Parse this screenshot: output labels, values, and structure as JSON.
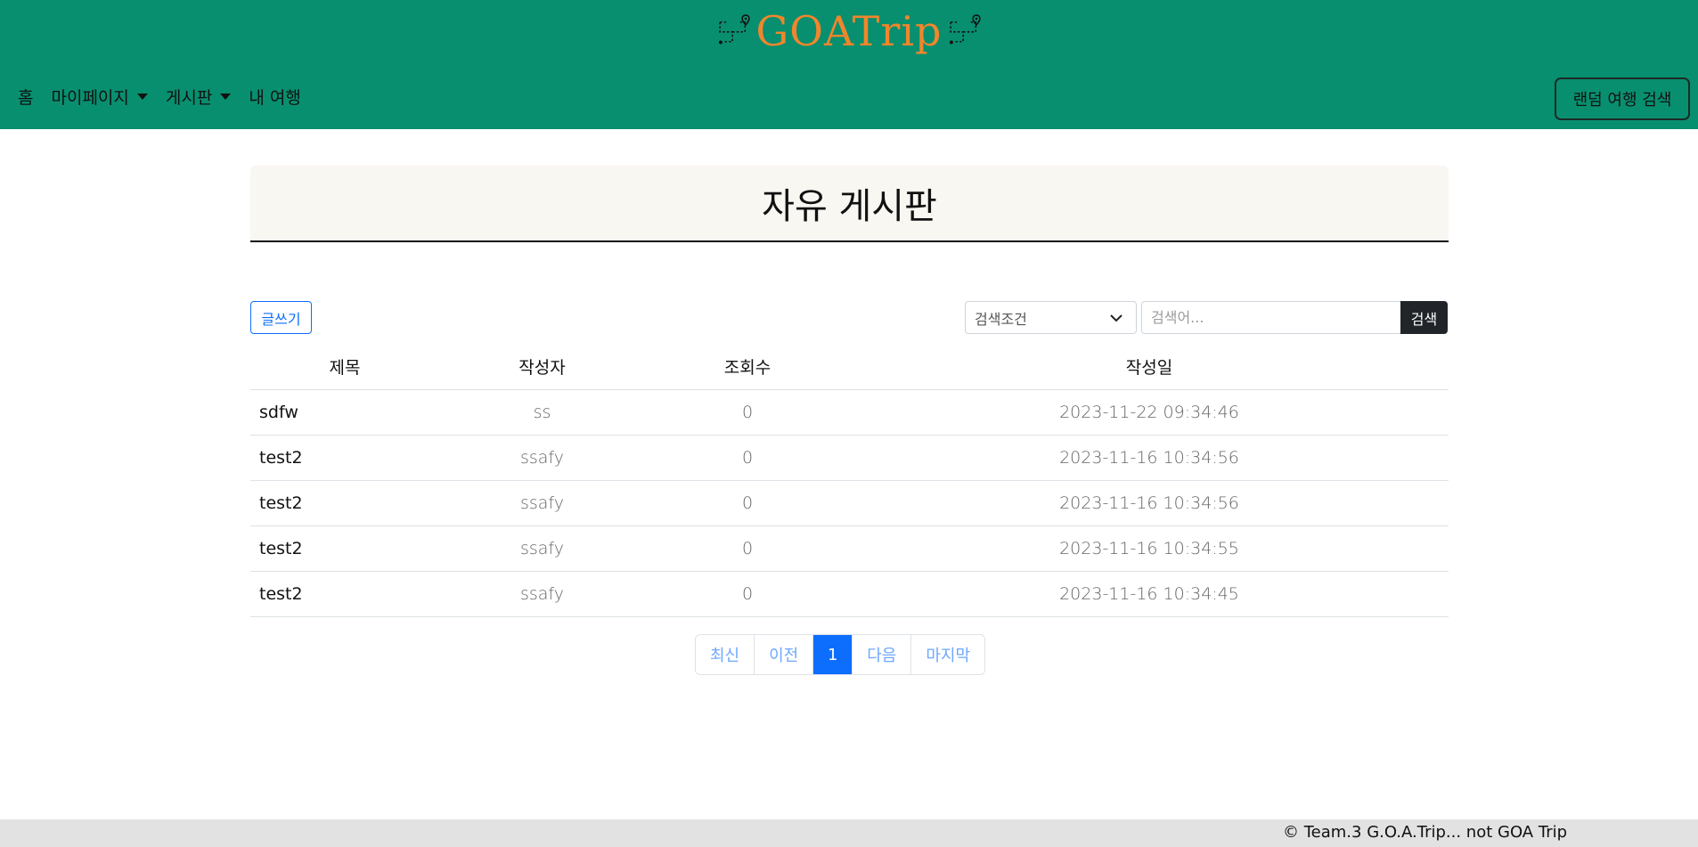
{
  "app": {
    "logo_text": "GOATrip"
  },
  "nav": {
    "home": "홈",
    "mypage": "마이페이지",
    "board": "게시판",
    "my_trip": "내 여행",
    "random_search": "랜덤 여행 검색"
  },
  "board": {
    "title": "자유 게시판",
    "write_label": "글쓰기",
    "search_condition": "검색조건",
    "search_placeholder": "검색어...",
    "search_label": "검색",
    "columns": {
      "title": "제목",
      "author": "작성자",
      "views": "조회수",
      "date": "작성일"
    },
    "rows": [
      {
        "title": "sdfw",
        "author": "ss",
        "views": "0",
        "date": "2023-11-22 09:34:46"
      },
      {
        "title": "test2",
        "author": "ssafy",
        "views": "0",
        "date": "2023-11-16 10:34:56"
      },
      {
        "title": "test2",
        "author": "ssafy",
        "views": "0",
        "date": "2023-11-16 10:34:56"
      },
      {
        "title": "test2",
        "author": "ssafy",
        "views": "0",
        "date": "2023-11-16 10:34:55"
      },
      {
        "title": "test2",
        "author": "ssafy",
        "views": "0",
        "date": "2023-11-16 10:34:45"
      }
    ]
  },
  "pagination": {
    "first": "최신",
    "prev": "이전",
    "current": "1",
    "next": "다음",
    "last": "마지막"
  },
  "footer": {
    "text": "© Team.3 G.O.A.Trip... not GOA Trip"
  },
  "colors": {
    "header_bg": "#088f6f",
    "logo": "#f0862c",
    "primary": "#0d6efd",
    "dark": "#212529"
  },
  "icons": {
    "logo_route": "route-pin-icon",
    "dropdown": "caret-down-icon",
    "select": "chevron-down-icon"
  }
}
